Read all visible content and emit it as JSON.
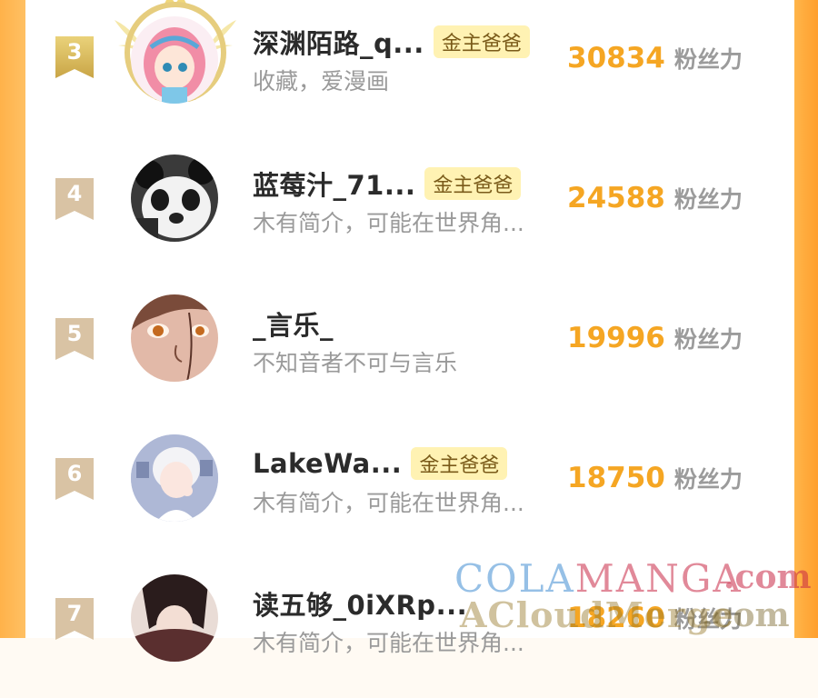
{
  "score_unit": "粉丝力",
  "rows": [
    {
      "rank": "3",
      "name": "深渊陌路_q...",
      "badge": "金主爸爸",
      "bio": "收藏，爱漫画",
      "score": "30834",
      "avatar_icon": "anime-girl-avatar-icon"
    },
    {
      "rank": "4",
      "name": "蓝莓汁_71...",
      "badge": "金主爸爸",
      "bio": "木有简介，可能在世界角...",
      "score": "24588",
      "avatar_icon": "panda-avatar-icon"
    },
    {
      "rank": "5",
      "name": "_言乐_",
      "badge": "",
      "bio": "不知音者不可与言乐",
      "score": "19996",
      "avatar_icon": "face-closeup-avatar-icon"
    },
    {
      "rank": "6",
      "name": "LakeWa...",
      "badge": "金主爸爸",
      "bio": "木有简介，可能在世界角...",
      "score": "18750",
      "avatar_icon": "white-hair-boy-avatar-icon"
    },
    {
      "rank": "7",
      "name": "读五够_0iXRp...",
      "badge": "",
      "bio": "木有简介，可能在世界角...",
      "score": "18260",
      "avatar_icon": "dark-hair-avatar-icon"
    }
  ],
  "watermark": {
    "line1_a": "COLA",
    "line1_b": "MANGA",
    "line1_com": ".com",
    "line2": "ACloudMerge",
    "line2_com": ".com"
  },
  "colors": {
    "frame": "#ffb24a",
    "score": "#f5a623",
    "badge_bg": "#fff2b3",
    "rank_flag": "#d8c2a3"
  }
}
